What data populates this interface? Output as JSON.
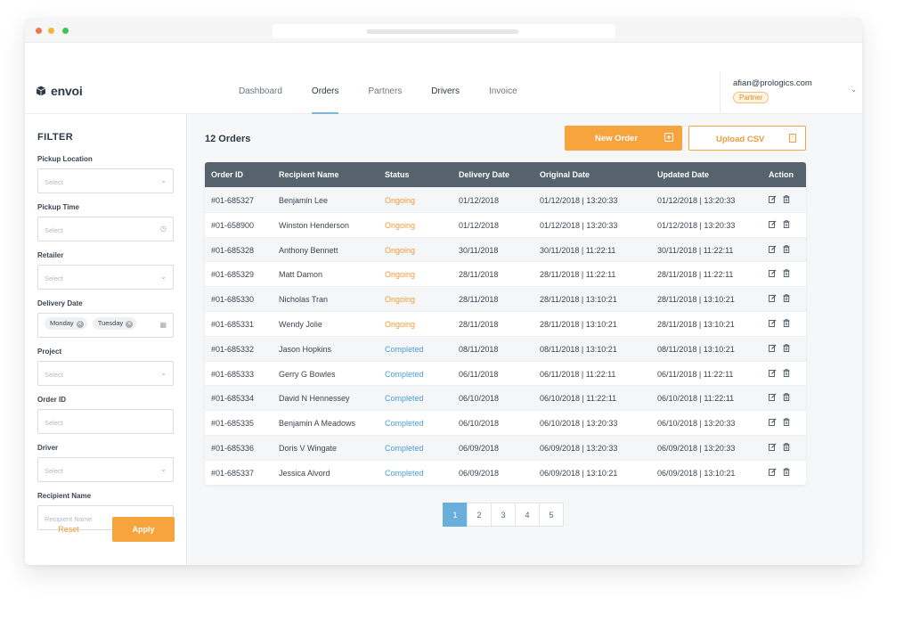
{
  "app": {
    "name": "envoi"
  },
  "nav": {
    "items": [
      "Dashboard",
      "Orders",
      "Partners",
      "Drivers",
      "Invoice"
    ],
    "active": "Orders"
  },
  "user": {
    "email": "afian@prologics.com",
    "role": "Partner"
  },
  "filter": {
    "title": "FILTER",
    "fields": {
      "pickup_location": {
        "label": "Pickup Location",
        "placeholder": "Select"
      },
      "pickup_time": {
        "label": "Pickup Time",
        "placeholder": "Select"
      },
      "retailer": {
        "label": "Retailer",
        "placeholder": "Select"
      },
      "delivery_date": {
        "label": "Delivery Date",
        "chips": [
          "Monday",
          "Tuesday"
        ]
      },
      "project": {
        "label": "Project",
        "placeholder": "Select"
      },
      "order_id": {
        "label": "Order ID",
        "placeholder": "Select"
      },
      "driver": {
        "label": "Driver",
        "placeholder": "Select"
      },
      "recipient_name": {
        "label": "Recipient Name",
        "placeholder": "Recipient Name"
      }
    },
    "reset_label": "Reset",
    "apply_label": "Apply"
  },
  "main": {
    "count_label": "12 Orders",
    "new_order_label": "New Order",
    "upload_label": "Upload CSV"
  },
  "table": {
    "headers": [
      "Order ID",
      "Recipient Name",
      "Status",
      "Delivery Date",
      "Original Date",
      "Updated Date",
      "Action"
    ],
    "rows": [
      [
        "#01-685327",
        "Benjamin Lee",
        "Ongoing",
        "01/12/2018",
        "01/12/2018 | 13:20:33",
        "01/12/2018 | 13:20:33"
      ],
      [
        "#01-658900",
        "Winston Henderson",
        "Ongoing",
        "01/12/2018",
        "01/12/2018 | 13:20:33",
        "01/12/2018 | 13:20:33"
      ],
      [
        "#01-685328",
        "Anthony Bennett",
        "Ongoing",
        "30/11/2018",
        "30/11/2018 | 11:22:11",
        "30/11/2018 | 11:22:11"
      ],
      [
        "#01-685329",
        "Matt Damon",
        "Ongoing",
        "28/11/2018",
        "28/11/2018 | 11:22:11",
        "28/11/2018 | 11:22:11"
      ],
      [
        "#01-685330",
        "Nicholas Tran",
        "Ongoing",
        "28/11/2018",
        "28/11/2018 | 13:10:21",
        "28/11/2018 | 13:10:21"
      ],
      [
        "#01-685331",
        "Wendy Jolie",
        "Ongoing",
        "28/11/2018",
        "28/11/2018 | 13:10:21",
        "28/11/2018 | 13:10:21"
      ],
      [
        "#01-685332",
        "Jason Hopkins",
        "Completed",
        "08/11/2018",
        "08/11/2018 | 13:10:21",
        "08/11/2018 | 13:10:21"
      ],
      [
        "#01-685333",
        "Gerry G Bowles",
        "Completed",
        "06/11/2018",
        "06/11/2018 | 11:22:11",
        "06/11/2018 | 11:22:11"
      ],
      [
        "#01-685334",
        "David N Hennessey",
        "Completed",
        "06/10/2018",
        "06/10/2018 | 11:22:11",
        "06/10/2018 | 11:22:11"
      ],
      [
        "#01-685335",
        "Benjamin A Meadows",
        "Completed",
        "06/10/2018",
        "06/10/2018 | 13:20:33",
        "06/10/2018 | 13:20:33"
      ],
      [
        "#01-685336",
        "Doris V Wingate",
        "Completed",
        "06/09/2018",
        "06/09/2018 | 13:20:33",
        "06/09/2018 | 13:20:33"
      ],
      [
        "#01-685337",
        "Jessica Alvord",
        "Completed",
        "06/09/2018",
        "06/09/2018 | 13:10:21",
        "06/09/2018 | 13:10:21"
      ]
    ],
    "row_actions": [
      "edit-icon",
      "trash-icon"
    ]
  },
  "pagination": {
    "pages": [
      "1",
      "2",
      "3",
      "4",
      "5"
    ],
    "current": "1"
  },
  "colors": {
    "accent": "#f7a33e",
    "header": "#56636e",
    "ongoing": "#f29a3a",
    "completed": "#4a9fd8",
    "active_page": "#6aaedb"
  }
}
